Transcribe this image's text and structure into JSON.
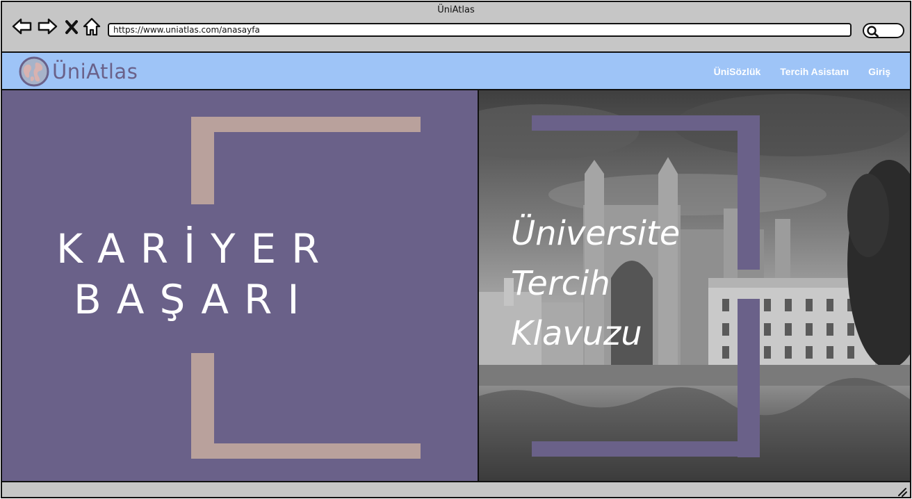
{
  "window": {
    "title": "ÜniAtlas"
  },
  "browser": {
    "url": "https://www.uniatlas.com/anasayfa",
    "icons": [
      "back-arrow-icon",
      "forward-arrow-icon",
      "close-icon",
      "home-icon",
      "search-icon"
    ]
  },
  "header": {
    "logo_text": "ÜniAtlas",
    "nav": [
      "ÜniSözlük",
      "Tercih Asistanı",
      "Giriş"
    ]
  },
  "hero_left": {
    "title_line1": "KARİYER",
    "title_line2": "BAŞARI"
  },
  "hero_right": {
    "title_line1": "Üniversite",
    "title_line2": "Tercih",
    "title_line3": "Klavuzu"
  },
  "colors": {
    "accent_purple": "#6a6189",
    "bracket_beige": "#b9a19c",
    "header_blue": "#9ec4f7",
    "chrome_gray": "#c6c6c6"
  }
}
